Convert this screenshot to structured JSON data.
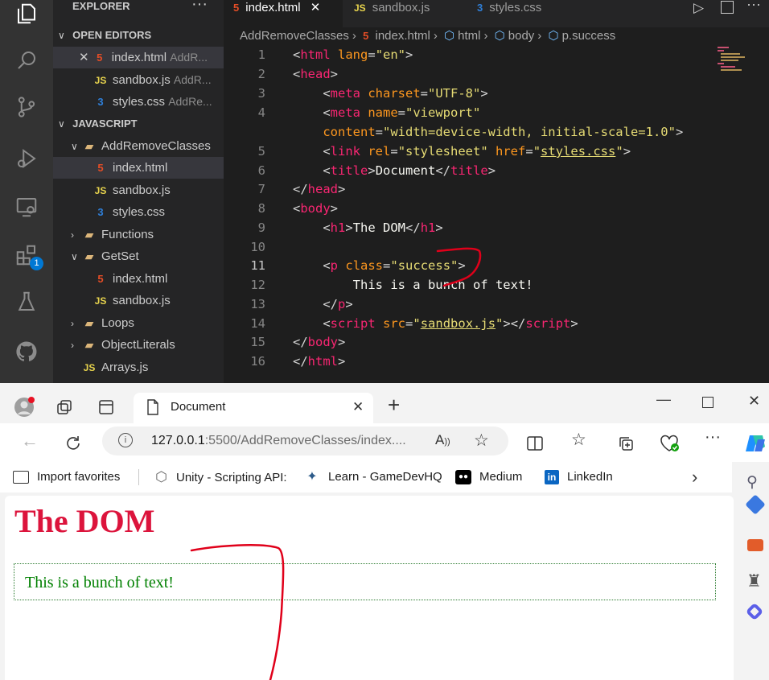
{
  "vscode": {
    "explorer_title": "EXPLORER",
    "open_editors_header": "OPEN EDITORS",
    "open_editors": [
      {
        "name": "index.html",
        "path": "AddR...",
        "type": "html"
      },
      {
        "name": "sandbox.js",
        "path": "AddR...",
        "type": "js"
      },
      {
        "name": "styles.css",
        "path": "AddRe...",
        "type": "css"
      }
    ],
    "workspace_header": "JAVASCRIPT",
    "tree": [
      {
        "label": "AddRemoveClasses",
        "kind": "folder-open"
      },
      {
        "label": "index.html",
        "kind": "html"
      },
      {
        "label": "sandbox.js",
        "kind": "js"
      },
      {
        "label": "styles.css",
        "kind": "css"
      },
      {
        "label": "Functions",
        "kind": "folder"
      },
      {
        "label": "GetSet",
        "kind": "folder-open"
      },
      {
        "label": "index.html",
        "kind": "html"
      },
      {
        "label": "sandbox.js",
        "kind": "js"
      },
      {
        "label": "Loops",
        "kind": "folder"
      },
      {
        "label": "ObjectLiterals",
        "kind": "folder"
      },
      {
        "label": "Arrays.js",
        "kind": "js"
      }
    ],
    "tabs": [
      {
        "label": "index.html",
        "type": "html",
        "active": true
      },
      {
        "label": "sandbox.js",
        "type": "js",
        "active": false
      },
      {
        "label": "styles.css",
        "type": "css",
        "active": false
      }
    ],
    "breadcrumb": [
      "AddRemoveClasses",
      "index.html",
      "html",
      "body",
      "p.success"
    ],
    "line_numbers": [
      "1",
      "2",
      "3",
      "4",
      "5",
      "6",
      "7",
      "8",
      "9",
      "10",
      "11",
      "12",
      "13",
      "14",
      "15",
      "16"
    ],
    "current_line": "11",
    "badge_count": "1",
    "icon_labels": {
      "html": "5",
      "js": "JS",
      "css": "3"
    }
  },
  "browser": {
    "tab_title": "Document",
    "url_host": "127.0.0.1",
    "url_rest": ":5500/AddRemoveClasses/index....",
    "favorites": [
      {
        "label": "Import favorites",
        "icon": "import-icon"
      },
      {
        "label": "Unity - Scripting API:",
        "icon": "unity-icon"
      },
      {
        "label": "Learn - GameDevHQ",
        "icon": "gamedevhq-icon"
      },
      {
        "label": "Medium",
        "icon": "medium-icon"
      },
      {
        "label": "LinkedIn",
        "icon": "linkedin-icon"
      }
    ],
    "page_heading": "The DOM",
    "page_paragraph": "This is a bunch of text!",
    "colors": {
      "heading": "#dc143c",
      "paragraph": "#008000",
      "annotation": "#e0001a"
    }
  }
}
